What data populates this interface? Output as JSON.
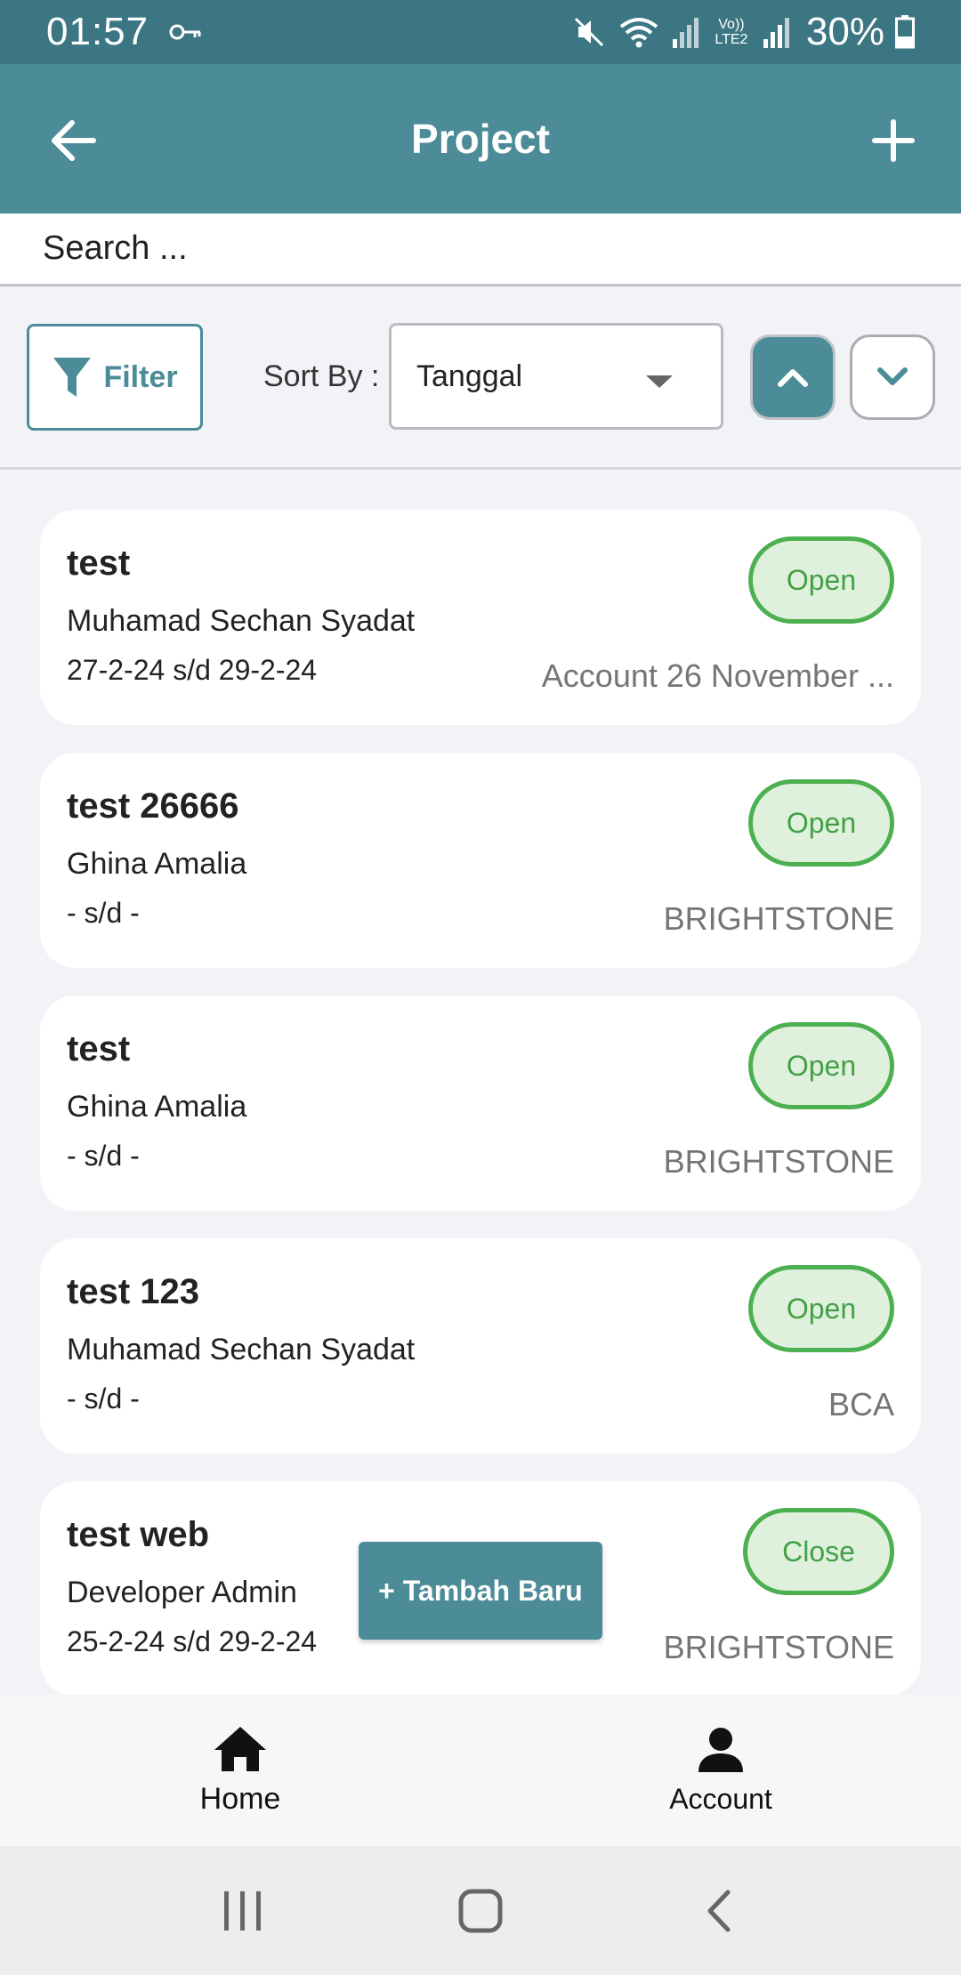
{
  "status_bar": {
    "time": "01:57",
    "lte_label": "Vo)) LTE2",
    "battery": "30%"
  },
  "app_bar": {
    "title": "Project",
    "back_icon": "arrow-left-icon",
    "add_icon": "plus-icon"
  },
  "search": {
    "placeholder": "Search ..."
  },
  "filters": {
    "filter_label": "Filter",
    "sort_label": "Sort By :",
    "sort_value": "Tanggal"
  },
  "projects": [
    {
      "title": "test",
      "person": "Muhamad Sechan Syadat",
      "dates": "27-2-24 s/d 29-2-24",
      "company": "Account 26 November ...",
      "status": "Open"
    },
    {
      "title": "test 26666",
      "person": "Ghina Amalia",
      "dates": "- s/d -",
      "company": "BRIGHTSTONE",
      "status": "Open"
    },
    {
      "title": "test",
      "person": "Ghina Amalia",
      "dates": "- s/d -",
      "company": "BRIGHTSTONE",
      "status": "Open"
    },
    {
      "title": "test 123",
      "person": "Muhamad Sechan Syadat",
      "dates": "- s/d -",
      "company": "BCA",
      "status": "Open"
    },
    {
      "title": "test web",
      "person": "Developer Admin",
      "dates": "25-2-24 s/d 29-2-24",
      "company": "BRIGHTSTONE",
      "status": "Close"
    }
  ],
  "fab": {
    "label": "+ Tambah Baru"
  },
  "bottom_nav": {
    "home_label": "Home",
    "account_label": "Account"
  },
  "colors": {
    "primary": "#4b8c98",
    "status_bar": "#3d7683",
    "status_green": "#4caf50",
    "status_fill": "#dff1dc"
  }
}
